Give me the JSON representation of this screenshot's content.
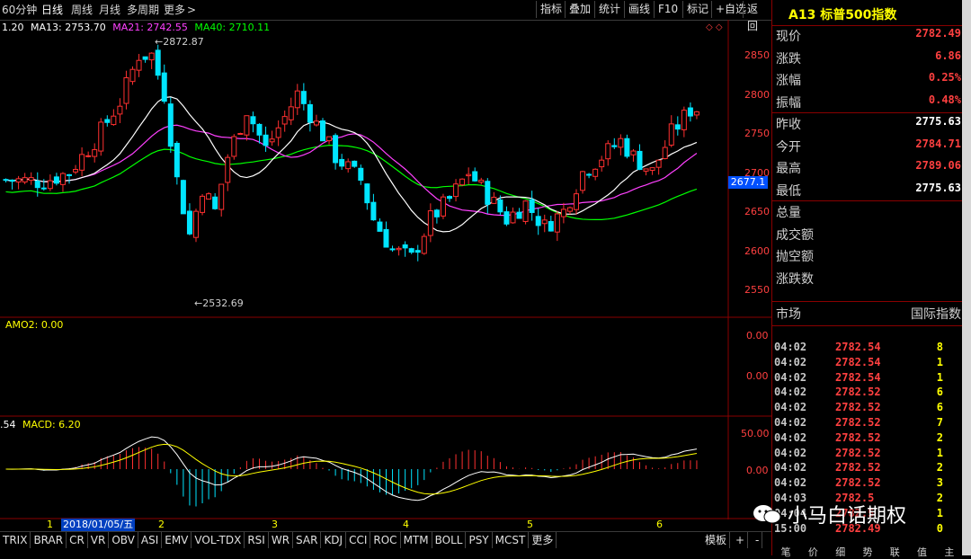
{
  "toolbar": {
    "period": "60分钟",
    "tabs": [
      "日线",
      "周线",
      "月线",
      "多周期",
      "更多"
    ],
    "right_buttons": [
      "指标",
      "叠加",
      "统计",
      "画线",
      "F10",
      "标记",
      "+自选",
      "返回"
    ],
    "more_arrow": ">"
  },
  "ma_legend": {
    "lead": "1.20",
    "ma13": "MA13: 2753.70",
    "ma21": "MA21: 2742.55",
    "ma40": "MA40: 2710.11",
    "ma13_color": "#ffffff",
    "ma21_color": "#ff40ff",
    "ma40_color": "#00ff00"
  },
  "price_axis": [
    "2850",
    "2800",
    "2750",
    "2700",
    "2650",
    "2600",
    "2550"
  ],
  "price_marker": "2677.1",
  "annotations": {
    "high": "2872.87",
    "low": "2532.69"
  },
  "amo": {
    "label": "AMO2: 0.00",
    "axis": [
      "0.00",
      "0.00"
    ]
  },
  "macd": {
    "lead": ".54",
    "label": "MACD: 6.20",
    "axis": [
      "50.00",
      "0.00"
    ]
  },
  "date_axis": {
    "marks": [
      "1",
      "2",
      "3",
      "4",
      "5",
      "6"
    ],
    "highlight": "2018/01/05/五"
  },
  "bottom_tabs": [
    "TRIX",
    "BRAR",
    "CR",
    "VR",
    "OBV",
    "ASI",
    "EMV",
    "VOL-TDX",
    "RSI",
    "WR",
    "SAR",
    "KDJ",
    "CCI",
    "ROC",
    "MTM",
    "BOLL",
    "PSY",
    "MCST",
    "更多"
  ],
  "bottom_right": {
    "template": "模板",
    "plus": "+",
    "minus": "-"
  },
  "quote": {
    "title": "A13 标普500指数",
    "rows": [
      {
        "label": "现价",
        "value": "2782.49",
        "color": "#ff4040"
      },
      {
        "label": "涨跌",
        "value": "6.86",
        "color": "#ff4040"
      },
      {
        "label": "涨幅",
        "value": "0.25%",
        "color": "#ff4040"
      },
      {
        "label": "振幅",
        "value": "0.48%",
        "color": "#ff4040"
      },
      {
        "label": "昨收",
        "value": "2775.63",
        "color": "#ffffff"
      },
      {
        "label": "今开",
        "value": "2784.71",
        "color": "#ff4040"
      },
      {
        "label": "最高",
        "value": "2789.06",
        "color": "#ff4040"
      },
      {
        "label": "最低",
        "value": "2775.63",
        "color": "#ffffff"
      },
      {
        "label": "总量",
        "value": "",
        "color": "#ffffff"
      },
      {
        "label": "成交额",
        "value": "",
        "color": "#ffffff"
      },
      {
        "label": "抛空额",
        "value": "",
        "color": "#ffffff"
      },
      {
        "label": "涨跌数",
        "value": "",
        "color": "#ffffff"
      }
    ],
    "market_label": "市场",
    "market_value": "国际指数"
  },
  "ticks": [
    {
      "t": "04:02",
      "p": "2782.54",
      "v": "8"
    },
    {
      "t": "04:02",
      "p": "2782.54",
      "v": "1"
    },
    {
      "t": "04:02",
      "p": "2782.54",
      "v": "1"
    },
    {
      "t": "04:02",
      "p": "2782.52",
      "v": "6"
    },
    {
      "t": "04:02",
      "p": "2782.52",
      "v": "6"
    },
    {
      "t": "04:02",
      "p": "2782.52",
      "v": "7"
    },
    {
      "t": "04:02",
      "p": "2782.52",
      "v": "2"
    },
    {
      "t": "04:02",
      "p": "2782.52",
      "v": "1"
    },
    {
      "t": "04:02",
      "p": "2782.52",
      "v": "2"
    },
    {
      "t": "04:02",
      "p": "2782.52",
      "v": "3"
    },
    {
      "t": "04:03",
      "p": "2782.5",
      "v": "2"
    },
    {
      "t": "04:04",
      "p": "2782.5",
      "v": "1"
    },
    {
      "t": "15:00",
      "p": "2782.49",
      "v": "0"
    }
  ],
  "panel_tabs": [
    "笔",
    "价",
    "细",
    "势",
    "联",
    "值",
    "主"
  ],
  "watermark": "小马白话期权",
  "colors": {
    "up": "#ff3030",
    "down": "#00ffff",
    "grid": "#800000",
    "text_yellow": "#ffff00"
  }
}
